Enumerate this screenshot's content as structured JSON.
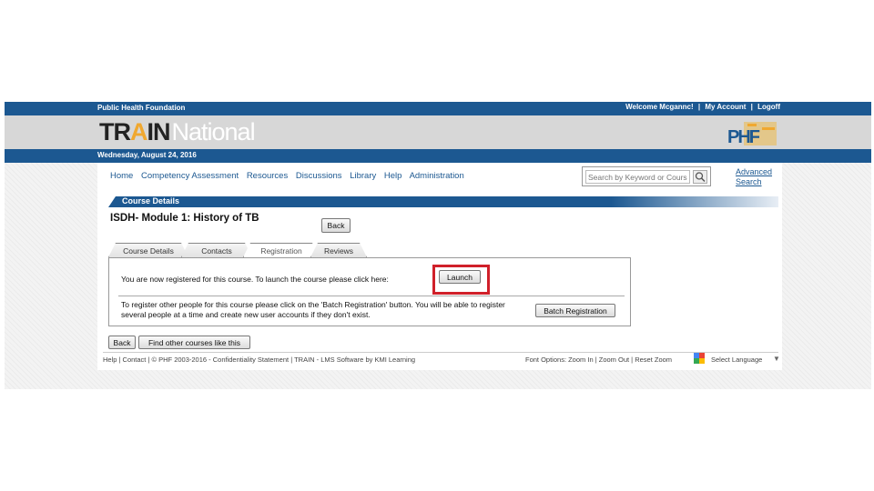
{
  "header": {
    "org_name": "Public Health Foundation",
    "welcome": "Welcome Mcgannc!",
    "my_account": "My Account",
    "logoff": "Logoff",
    "sep": "|",
    "logo_train": "TR",
    "logo_bolt": "A",
    "logo_in": "IN",
    "logo_national": "National",
    "date": "Wednesday, August 24, 2016",
    "phf_logo_text": "PHF"
  },
  "nav": {
    "items": [
      {
        "label": "Home"
      },
      {
        "label": "Competency Assessment"
      },
      {
        "label": "Resources"
      },
      {
        "label": "Discussions"
      },
      {
        "label": "Library"
      },
      {
        "label": "Help"
      },
      {
        "label": "Administration"
      }
    ]
  },
  "search": {
    "placeholder": "Search by Keyword or Course ID",
    "icon": "search-icon",
    "advanced_line1": "Advanced",
    "advanced_line2": "Search"
  },
  "section": {
    "title": "Course Details"
  },
  "course": {
    "title": "ISDH- Module 1: History of TB",
    "back_label": "Back"
  },
  "tabs": [
    {
      "label": "Course Details",
      "active": false
    },
    {
      "label": "Contacts",
      "active": false
    },
    {
      "label": "Registration",
      "active": true
    },
    {
      "label": "Reviews",
      "active": false
    }
  ],
  "registration": {
    "message": "You are now registered for this course. To launch the course please click here:",
    "launch_label": "Launch",
    "batch_message": "To register other people for this course please click on the 'Batch Registration' button. You will be able to register several people at a time and create new user accounts if they don't exist.",
    "batch_label": "Batch Registration",
    "highlight_color": "#d0202a"
  },
  "bottom_buttons": {
    "back_label": "Back",
    "find_label": "Find other courses like this"
  },
  "footer": {
    "left": "Help | Contact | © PHF 2003-2016 - Confidentiality Statement | TRAIN - LMS Software by KMI Learning",
    "right": "Font Options: Zoom In | Zoom Out | Reset Zoom",
    "language": "Select Language",
    "language_arrow": "▼"
  },
  "colors": {
    "brand_blue": "#1c5891",
    "banner_gray": "#d7d7d7"
  }
}
